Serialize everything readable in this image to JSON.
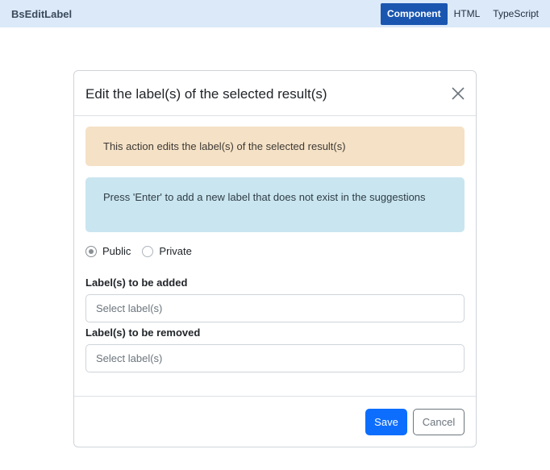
{
  "app": {
    "title": "BsEditLabel"
  },
  "tabs": [
    {
      "label": "Component",
      "active": true
    },
    {
      "label": "HTML",
      "active": false
    },
    {
      "label": "TypeScript",
      "active": false
    }
  ],
  "modal": {
    "title": "Edit the label(s) of the selected result(s)",
    "alerts": {
      "warning": "This action edits the label(s) of the selected result(s)",
      "info": "Press 'Enter' to add a new label that does not exist in the suggestions"
    },
    "visibility": {
      "options": [
        {
          "label": "Public",
          "checked": true
        },
        {
          "label": "Private",
          "checked": false
        }
      ]
    },
    "add_labels": {
      "label": "Label(s) to be added",
      "placeholder": "Select label(s)"
    },
    "remove_labels": {
      "label": "Label(s) to be removed",
      "placeholder": "Select label(s)"
    },
    "footer": {
      "save_label": "Save",
      "cancel_label": "Cancel"
    }
  },
  "colors": {
    "primary": "#0d6efd",
    "active_tab": "#1a56b0",
    "topbar": "#dbe9f9",
    "warning_bg": "#f5e1c6",
    "info_bg": "#c9e5f0"
  },
  "icons": {
    "close": "close-icon"
  }
}
